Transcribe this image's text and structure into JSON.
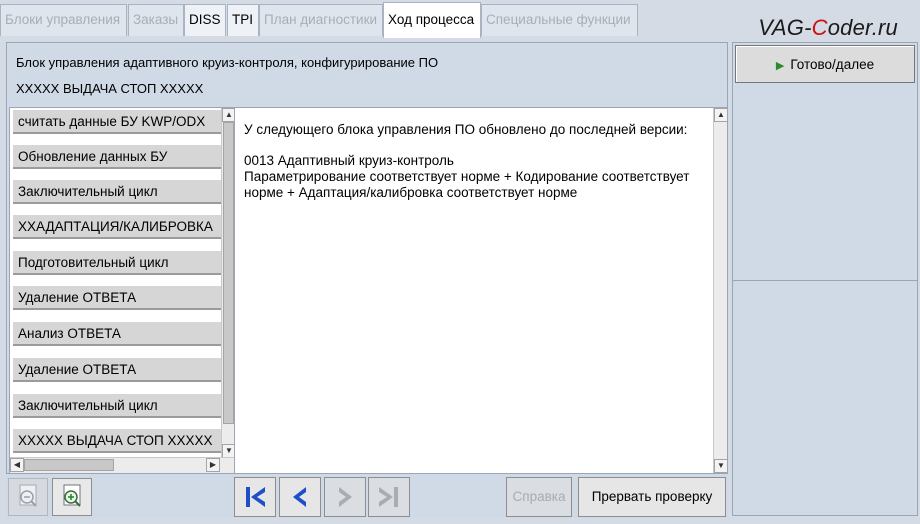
{
  "tabs": [
    {
      "label": "Блоки управления",
      "state": "disabled"
    },
    {
      "label": "Заказы",
      "state": "disabled"
    },
    {
      "label": "DISS",
      "state": "enabled"
    },
    {
      "label": "TPI",
      "state": "enabled"
    },
    {
      "label": "План диагностики",
      "state": "disabled"
    },
    {
      "label": "Ход процесса",
      "state": "active"
    },
    {
      "label": "Специальные функции",
      "state": "disabled"
    }
  ],
  "watermark": {
    "part1": "VAG-",
    "part2": "C",
    "part3": "oder.ru"
  },
  "header": {
    "title": "Блок управления адаптивного круиз-контроля, конфигурирование ПО",
    "status": "XXXXX ВЫДАЧА СТОП XXXXX"
  },
  "steps": [
    "считать данные БУ KWP/ODX",
    "Обновление данных БУ",
    "Заключительный цикл",
    "XXАДАПТАЦИЯ/КАЛИБРОВКА",
    "Подготовительный цикл",
    "Удаление ОТВЕТА",
    "Анализ ОТВЕТА",
    "Удаление ОТВЕТА",
    "Заключительный цикл",
    "XXXXX ВЫДАЧА СТОП XXXXX"
  ],
  "message": {
    "line1": "У следующего блока управления ПО обновлено до последней версии:",
    "line2": "0013 Адаптивный круиз-контроль",
    "line3": "Параметрирование соответствует норме + Кодирование соответствует",
    "line4": "норме + Адаптация/калибровка соответствует норме"
  },
  "buttons": {
    "ready": "Готово/далее",
    "help": "Справка",
    "abort": "Прервать проверку"
  },
  "icons": {
    "zoom_out": "zoom-out-icon",
    "zoom_in": "zoom-in-icon",
    "first": "first-icon",
    "back": "back-icon",
    "forward": "forward-icon",
    "last": "last-icon",
    "ready_arrow": "play-icon"
  },
  "colors": {
    "accent_blue": "#1f4fc8",
    "ready_arrow": "#2b8a2b",
    "watermark_red": "#d10d0d"
  }
}
